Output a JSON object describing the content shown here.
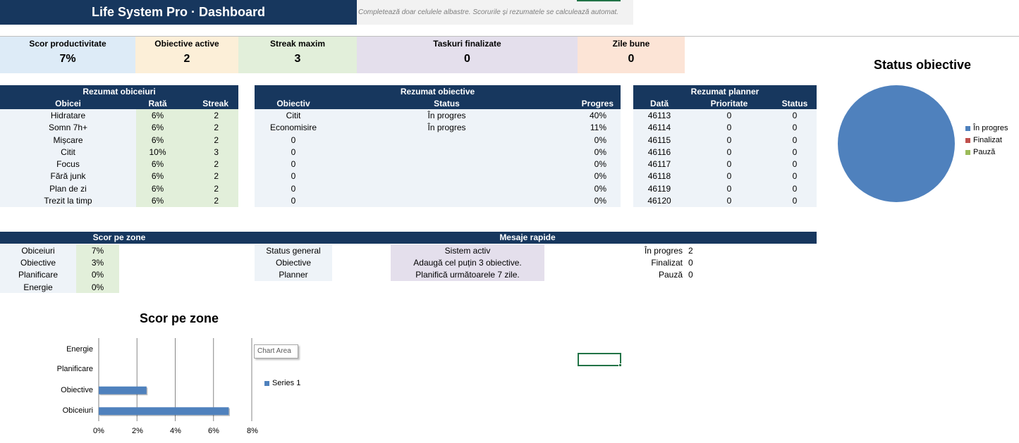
{
  "header": {
    "title": "Life System Pro · Dashboard",
    "subtitle": "Completează doar celulele albastre. Scorurile și rezumatele se calculează automat."
  },
  "kpis": [
    {
      "label": "Scor productivitate",
      "value": "7%",
      "color": "#ddebf7"
    },
    {
      "label": "Obiective active",
      "value": "2",
      "color": "#fcefd8"
    },
    {
      "label": "Streak maxim",
      "value": "3",
      "color": "#e2efda"
    },
    {
      "label": "Taskuri finalizate",
      "value": "0",
      "color": "#e4dfec"
    },
    {
      "label": "Zile bune",
      "value": "0",
      "color": "#fce4d6"
    }
  ],
  "habits": {
    "title": "Rezumat obiceiuri",
    "columns": [
      "Obicei",
      "Rată",
      "Streak"
    ],
    "rows": [
      {
        "name": "Hidratare",
        "rate": "6%",
        "streak": "2"
      },
      {
        "name": "Somn 7h+",
        "rate": "6%",
        "streak": "2"
      },
      {
        "name": "Mișcare",
        "rate": "6%",
        "streak": "2"
      },
      {
        "name": "Citit",
        "rate": "10%",
        "streak": "3"
      },
      {
        "name": "Focus",
        "rate": "6%",
        "streak": "2"
      },
      {
        "name": "Fără junk",
        "rate": "6%",
        "streak": "2"
      },
      {
        "name": "Plan de zi",
        "rate": "6%",
        "streak": "2"
      },
      {
        "name": "Trezit la timp",
        "rate": "6%",
        "streak": "2"
      }
    ]
  },
  "goals": {
    "title": "Rezumat obiective",
    "columns": [
      "Obiectiv",
      "Status",
      "Progres"
    ],
    "rows": [
      {
        "goal": "Citit",
        "status": "În progres",
        "progress": "40%"
      },
      {
        "goal": "Economisire",
        "status": "În progres",
        "progress": "11%"
      },
      {
        "goal": "0",
        "status": "",
        "progress": "0%"
      },
      {
        "goal": "0",
        "status": "",
        "progress": "0%"
      },
      {
        "goal": "0",
        "status": "",
        "progress": "0%"
      },
      {
        "goal": "0",
        "status": "",
        "progress": "0%"
      },
      {
        "goal": "0",
        "status": "",
        "progress": "0%"
      },
      {
        "goal": "0",
        "status": "",
        "progress": "0%"
      }
    ]
  },
  "planner": {
    "title": "Rezumat planner",
    "columns": [
      "Dată",
      "Prioritate",
      "Status"
    ],
    "rows": [
      {
        "date": "46113",
        "priority": "0",
        "status": "0"
      },
      {
        "date": "46114",
        "priority": "0",
        "status": "0"
      },
      {
        "date": "46115",
        "priority": "0",
        "status": "0"
      },
      {
        "date": "46116",
        "priority": "0",
        "status": "0"
      },
      {
        "date": "46117",
        "priority": "0",
        "status": "0"
      },
      {
        "date": "46118",
        "priority": "0",
        "status": "0"
      },
      {
        "date": "46119",
        "priority": "0",
        "status": "0"
      },
      {
        "date": "46120",
        "priority": "0",
        "status": "0"
      }
    ]
  },
  "zones": {
    "title": "Scor pe zone",
    "rows": [
      {
        "name": "Obiceiuri",
        "value": "7%"
      },
      {
        "name": "Obiective",
        "value": "3%"
      },
      {
        "name": "Planificare",
        "value": "0%"
      },
      {
        "name": "Energie",
        "value": "0%"
      }
    ]
  },
  "messages": {
    "title": "Mesaje rapide",
    "rows": [
      {
        "label": "Status general",
        "text": "Sistem activ"
      },
      {
        "label": "Obiective",
        "text": "Adaugă cel puțin 3 obiective."
      },
      {
        "label": "Planner",
        "text": "Planifică următoarele 7 zile."
      }
    ]
  },
  "status_counts": [
    {
      "label": "În progres",
      "value": "2"
    },
    {
      "label": "Finalizat",
      "value": "0"
    },
    {
      "label": "Pauză",
      "value": "0"
    }
  ],
  "chart_area_tooltip": "Chart Area",
  "chart_data": [
    {
      "type": "pie",
      "title": "Status obiective",
      "categories": [
        "În progres",
        "Finalizat",
        "Pauză"
      ],
      "values": [
        2,
        0,
        0
      ],
      "colors": [
        "#4f81bd",
        "#c0504d",
        "#9bbb59"
      ],
      "legend": "right"
    },
    {
      "type": "bar",
      "orientation": "horizontal",
      "title": "Scor pe zone",
      "categories": [
        "Obiceiuri",
        "Obiective",
        "Planificare",
        "Energie"
      ],
      "series": [
        {
          "name": "Series 1",
          "values": [
            0.068,
            0.025,
            0,
            0
          ],
          "color": "#4f81bd"
        }
      ],
      "xlim": [
        0,
        0.08
      ],
      "ticks": [
        "0%",
        "2%",
        "4%",
        "6%",
        "8%"
      ],
      "grid": true,
      "legend": "right"
    }
  ]
}
